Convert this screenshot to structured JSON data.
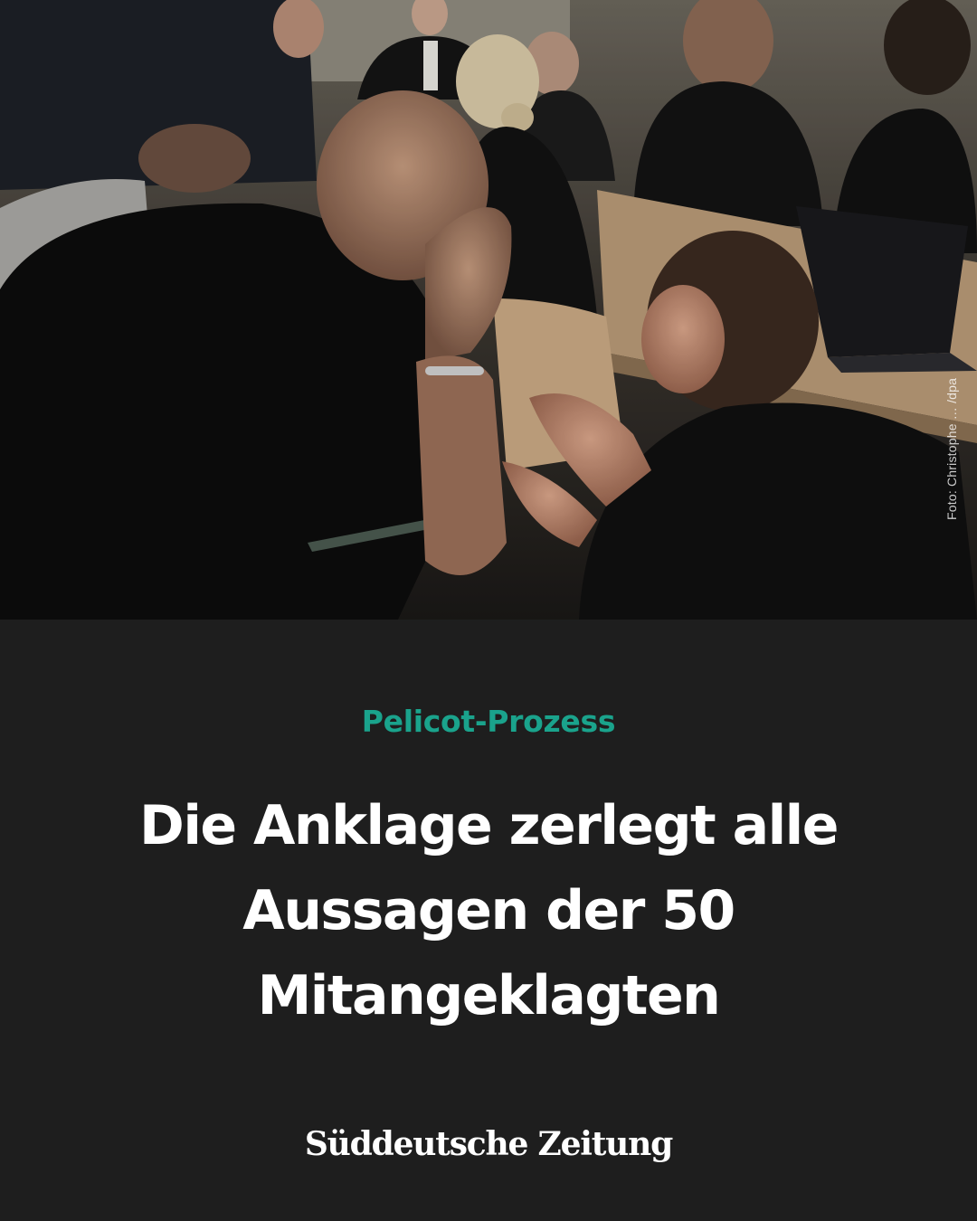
{
  "photo": {
    "credit": "Foto: Christophe … /dpa"
  },
  "article": {
    "kicker": "Pelicot-Prozess",
    "headline": "Die Anklage zerlegt alle Aussagen der 50 Mitangeklagten"
  },
  "brand": {
    "name": "Süddeutsche Zeitung"
  },
  "colors": {
    "background": "#1e1e1e",
    "kicker": "#1aa38c",
    "text": "#ffffff"
  }
}
